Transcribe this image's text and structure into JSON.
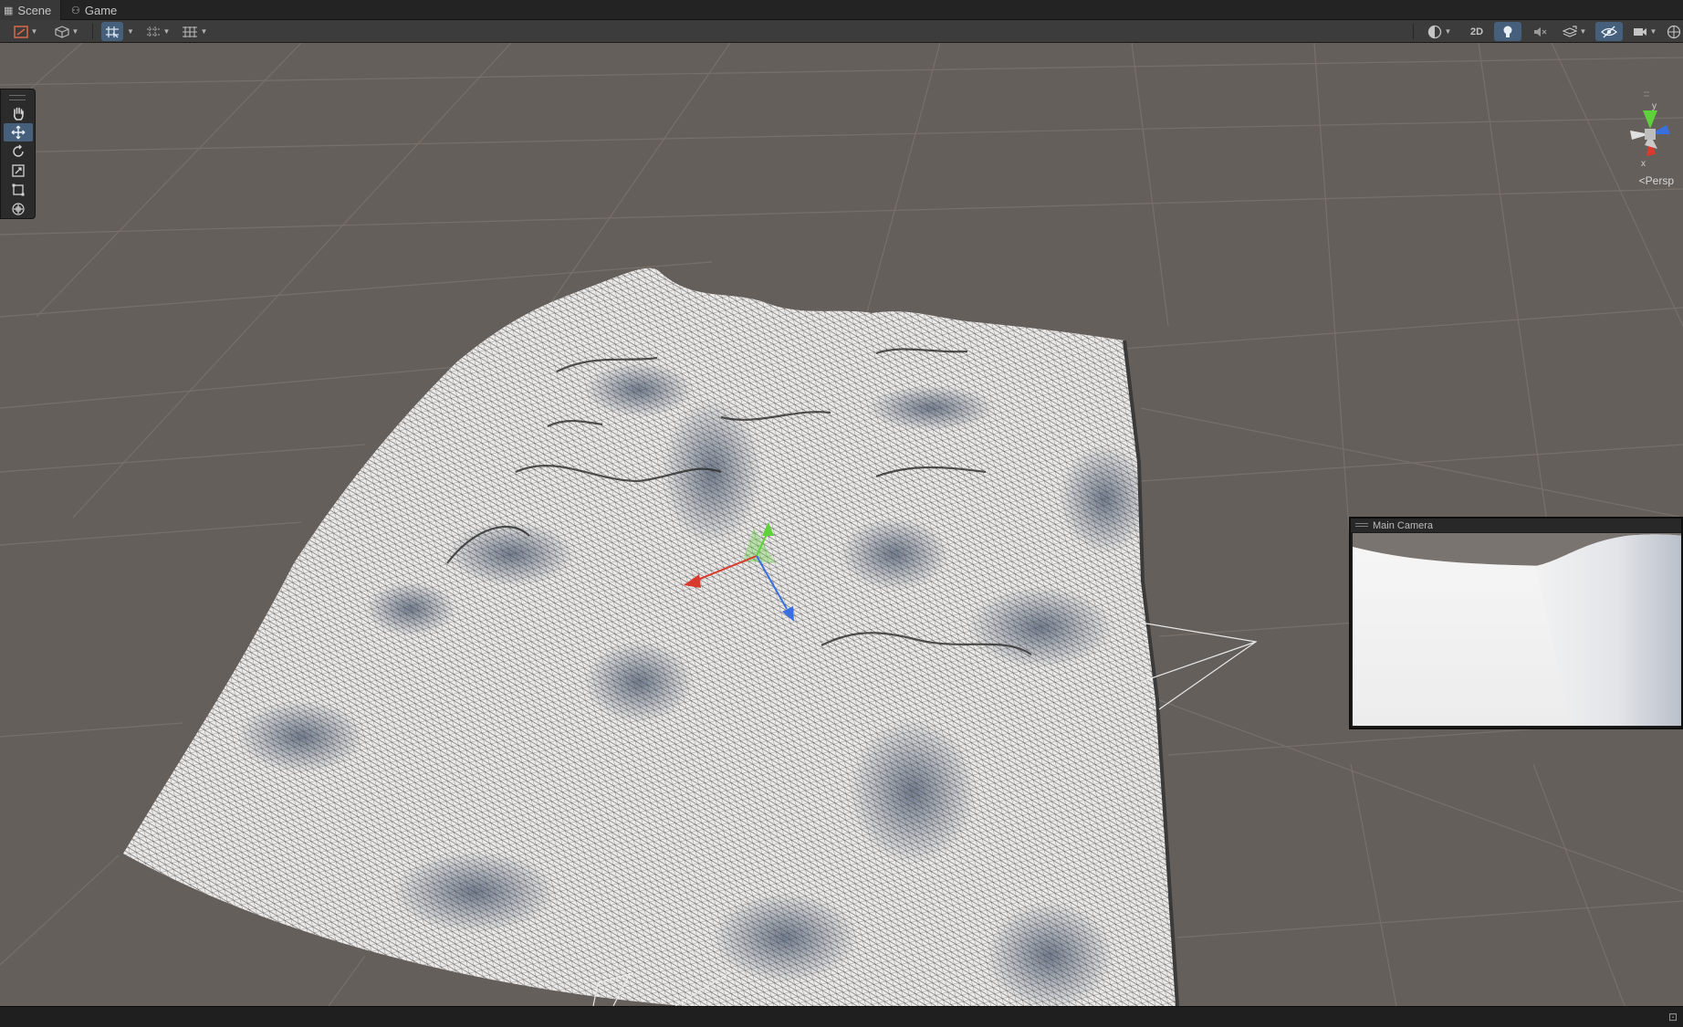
{
  "tabs": [
    {
      "label": "Scene",
      "icon": "grid-icon"
    },
    {
      "label": "Game",
      "icon": "gamepad-icon"
    }
  ],
  "toolbar": {
    "mode_2d_label": "2D"
  },
  "gizmo": {
    "y_label": "y",
    "x_label": "x",
    "projection_label": "Persp"
  },
  "camera_preview": {
    "title": "Main Camera"
  },
  "colors": {
    "viewport_bg": "#655f5b",
    "active_button": "#46607c",
    "axis_x": "#d83a2e",
    "axis_y": "#5fd13a",
    "axis_z": "#3a6fe0"
  }
}
